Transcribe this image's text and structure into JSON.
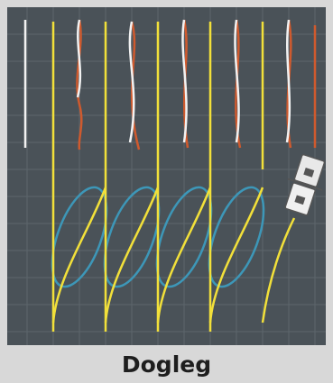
{
  "caption": {
    "title": "Dogleg"
  },
  "colors": {
    "background": "#4a5258",
    "grid": "#5d666c",
    "yarn_yellow": "#f2e03a",
    "yarn_white": "#f2f2f2",
    "yarn_orange": "#cf5a2e",
    "loop_blue": "#3d97b8",
    "card": "#d8d8d8",
    "caption_text": "#1e1e1e"
  },
  "icons": [
    "crossing-tool-icon"
  ]
}
